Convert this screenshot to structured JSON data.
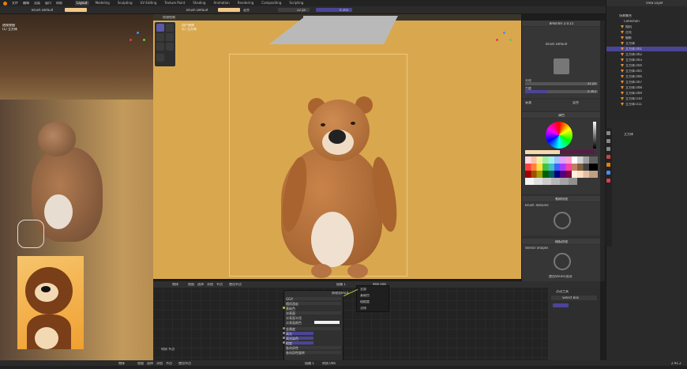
{
  "topbar": {
    "menus": [
      "文件",
      "编辑",
      "渲染",
      "窗口",
      "帮助"
    ],
    "tabs": [
      "Layout",
      "Modeling",
      "Sculpting",
      "UV Editing",
      "Texture Paint",
      "Shading",
      "Animation",
      "Rendering",
      "Compositing",
      "Scripting"
    ],
    "active_tab": "Layout",
    "scene": "Scene",
    "view_layer": "View Layer"
  },
  "toolheader": {
    "brush_left": "Brush Default",
    "brush_main": "Brush Default",
    "radius": "22 px",
    "strength": "0.303",
    "mix": "混合"
  },
  "left_viewport": {
    "mode": "纹理绘制",
    "label1": "透视视图",
    "label2": "(1) 立方体"
  },
  "viewport": {
    "mode": "纹理绘制",
    "label1": "用户透视",
    "label2": "(1) 立方体"
  },
  "npanel": {
    "title": "BPainter 2.0.15",
    "brush_name": "Brush Default",
    "radius_label": "半径",
    "radius_value": "22 px",
    "strength_label": "力度",
    "strength_value": "0.303",
    "falloff_label": "衰减",
    "blend_label": "混合",
    "palette_label": "调色",
    "brush_textures": "Brush Textures",
    "stencil_shapes": "Stencil Shapes",
    "tex_section": "笔刷纹理",
    "stencil_section": "模板纹理",
    "apply_stencil": "使用Stencil选项"
  },
  "outliner": {
    "title": "场景集合",
    "collection": "Collection",
    "items": [
      "相机",
      "点光",
      "摄影",
      "立方体",
      "立方体.001",
      "立方体.002",
      "立方体.003",
      "立方体.004",
      "立方体.005",
      "立方体.006",
      "立方体.007",
      "立方体.008",
      "立方体.009",
      "立方体.010",
      "立方体.011"
    ],
    "selected_index": 4
  },
  "props": {
    "object_label": "立方体"
  },
  "node_editor": {
    "object_menu": "物体",
    "menus": [
      "视图",
      "选择",
      "添加",
      "节点"
    ],
    "use_nodes": "使用节点",
    "slot": "插槽 1",
    "material": "材质.006",
    "node_title": "原理化BSDF",
    "node_gx": "GGX",
    "node_rand": "随机游走",
    "fields": [
      "基础色",
      "次表面",
      "次表面半径",
      "次表面颜色",
      "金属度",
      "高光",
      "高光染色",
      "糙度",
      "各向异性",
      "各向异性旋转"
    ],
    "values": [
      "0.000",
      "",
      "",
      "0.000",
      "0.500",
      "0.000",
      "0.500",
      "0.000",
      "0.000"
    ],
    "dropdown": [
      "全部",
      "基础色",
      "粗糙度",
      "法线"
    ],
    "frame_label": "材质 节点",
    "bottom_node": "Diffuse Shader"
  },
  "ntool": {
    "title": "活动工具",
    "tool": "Select Box"
  },
  "bottom": {
    "mode": "物体",
    "view": "视图",
    "select": "选择",
    "add": "添加",
    "node": "节点",
    "use_nodes": "使用节点",
    "slot": "插槽 1",
    "material": "材质.006",
    "version": "2.91.2"
  },
  "colors": {
    "accent": "#4b4596",
    "viewport_bg": "#d9a84e",
    "bear_body": "#b06a35",
    "selection_orange": "#e87d0d"
  }
}
